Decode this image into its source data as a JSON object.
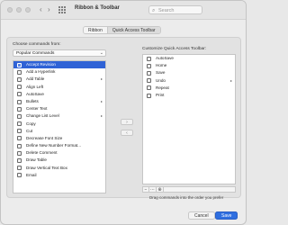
{
  "window": {
    "title": "Ribbon & Toolbar"
  },
  "search": {
    "placeholder": "Search",
    "icon": "magnifier-icon"
  },
  "tabs": [
    {
      "label": "Ribbon",
      "active": false
    },
    {
      "label": "Quick Access Toolbar",
      "active": true
    }
  ],
  "left": {
    "label": "Choose commands from:",
    "dropdown_value": "Popular Commands",
    "items": [
      {
        "label": "Accept Revision",
        "selected": true
      },
      {
        "label": "Add a Hyperlink"
      },
      {
        "label": "Add Table",
        "submenu": "▸"
      },
      {
        "label": "Align Left"
      },
      {
        "label": "AutoSave"
      },
      {
        "label": "Bullets",
        "submenu": "▸"
      },
      {
        "label": "Center Text"
      },
      {
        "label": "Change List Level",
        "submenu": "▸"
      },
      {
        "label": "Copy"
      },
      {
        "label": "Cut"
      },
      {
        "label": "Decrease Font Size"
      },
      {
        "label": "Define New Number Format..."
      },
      {
        "label": "Delete Comment"
      },
      {
        "label": "Draw Table"
      },
      {
        "label": "Draw Vertical Text Box"
      },
      {
        "label": "Email"
      }
    ]
  },
  "right": {
    "label": "Customize Quick Access Toolbar:",
    "items": [
      {
        "label": "AutoSave"
      },
      {
        "label": "Home"
      },
      {
        "label": "Save"
      },
      {
        "label": "Undo",
        "submenu": "▸"
      },
      {
        "label": "Repeat"
      },
      {
        "label": "Print"
      }
    ],
    "hint": "Drag commands into the order you prefer"
  },
  "buttons": {
    "add": "›",
    "remove": "‹",
    "cancel": "Cancel",
    "save": "Save"
  },
  "list_tools": [
    "−",
    "⋯",
    "⊕"
  ],
  "colors": {
    "selection": "#2f62d6",
    "primary_button": "#2f6fe0"
  }
}
